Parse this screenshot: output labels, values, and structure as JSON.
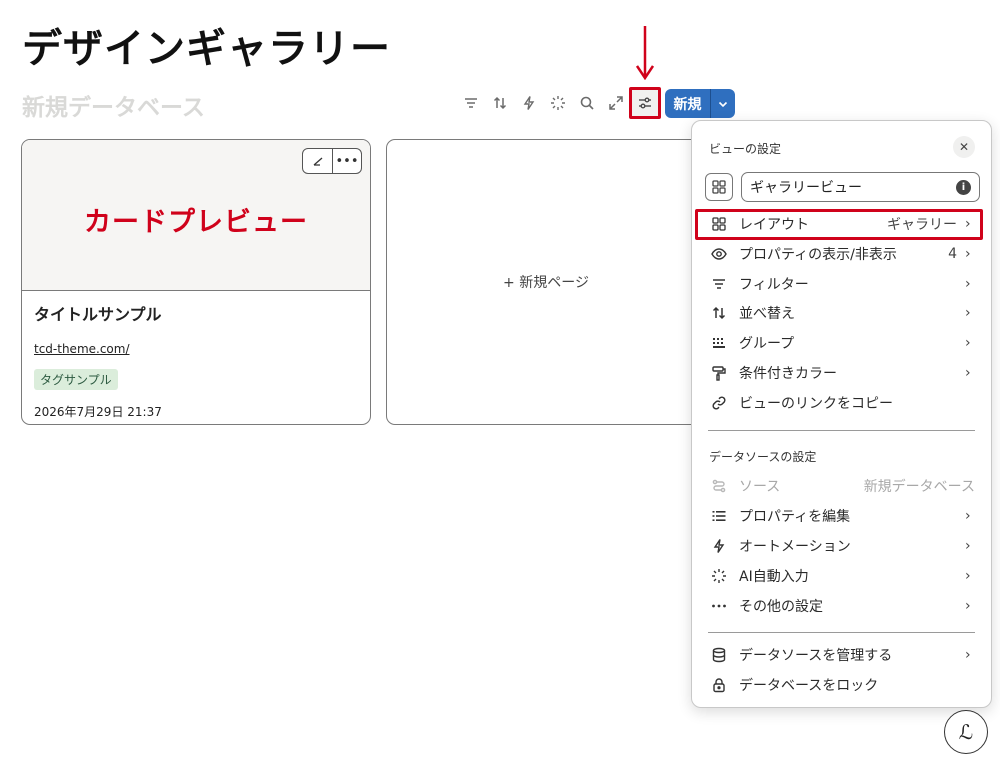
{
  "page": {
    "title": "デザインギャラリー",
    "database_title": "新規データベース"
  },
  "toolbar": {
    "icons": [
      "filter-icon",
      "sort-icon",
      "automation-icon",
      "ai-autofill-icon",
      "search-icon",
      "expand-icon",
      "view-settings-icon"
    ],
    "new_label": "新規"
  },
  "gallery": {
    "card": {
      "preview_text": "カードプレビュー",
      "title": "タイトルサンプル",
      "url": "tcd-theme.com/",
      "tag": "タグサンプル",
      "date": "2026年7月29日 21:37"
    },
    "new_page_label": "+ 新規ページ"
  },
  "panel": {
    "header": "ビューの設定",
    "view_name": "ギャラリービュー",
    "view_items": [
      {
        "icon": "layout-grid-icon",
        "label": "レイアウト",
        "value": "ギャラリー"
      },
      {
        "icon": "eye-icon",
        "label": "プロパティの表示/非表示",
        "value": "4"
      },
      {
        "icon": "filter-icon",
        "label": "フィルター",
        "value": ""
      },
      {
        "icon": "sort-icon",
        "label": "並べ替え",
        "value": ""
      },
      {
        "icon": "group-icon",
        "label": "グループ",
        "value": ""
      },
      {
        "icon": "paint-roller-icon",
        "label": "条件付きカラー",
        "value": ""
      },
      {
        "icon": "link-icon",
        "label": "ビューのリンクをコピー",
        "value": ""
      }
    ],
    "datasource_header": "データソースの設定",
    "datasource_items": [
      {
        "icon": "source-icon",
        "label": "ソース",
        "value": "新規データベース"
      },
      {
        "icon": "list-icon",
        "label": "プロパティを編集",
        "value": ""
      },
      {
        "icon": "lightning-icon",
        "label": "オートメーション",
        "value": ""
      },
      {
        "icon": "sparkle-icon",
        "label": "AI自動入力",
        "value": ""
      },
      {
        "icon": "more-icon",
        "label": "その他の設定",
        "value": ""
      }
    ],
    "footer_items": [
      {
        "icon": "database-icon",
        "label": "データソースを管理する"
      },
      {
        "icon": "lock-icon",
        "label": "データベースをロック"
      }
    ]
  },
  "colors": {
    "accent_blue": "#2f6fbf",
    "annotation_red": "#d0021b",
    "tag_bg": "#dbeddb"
  }
}
